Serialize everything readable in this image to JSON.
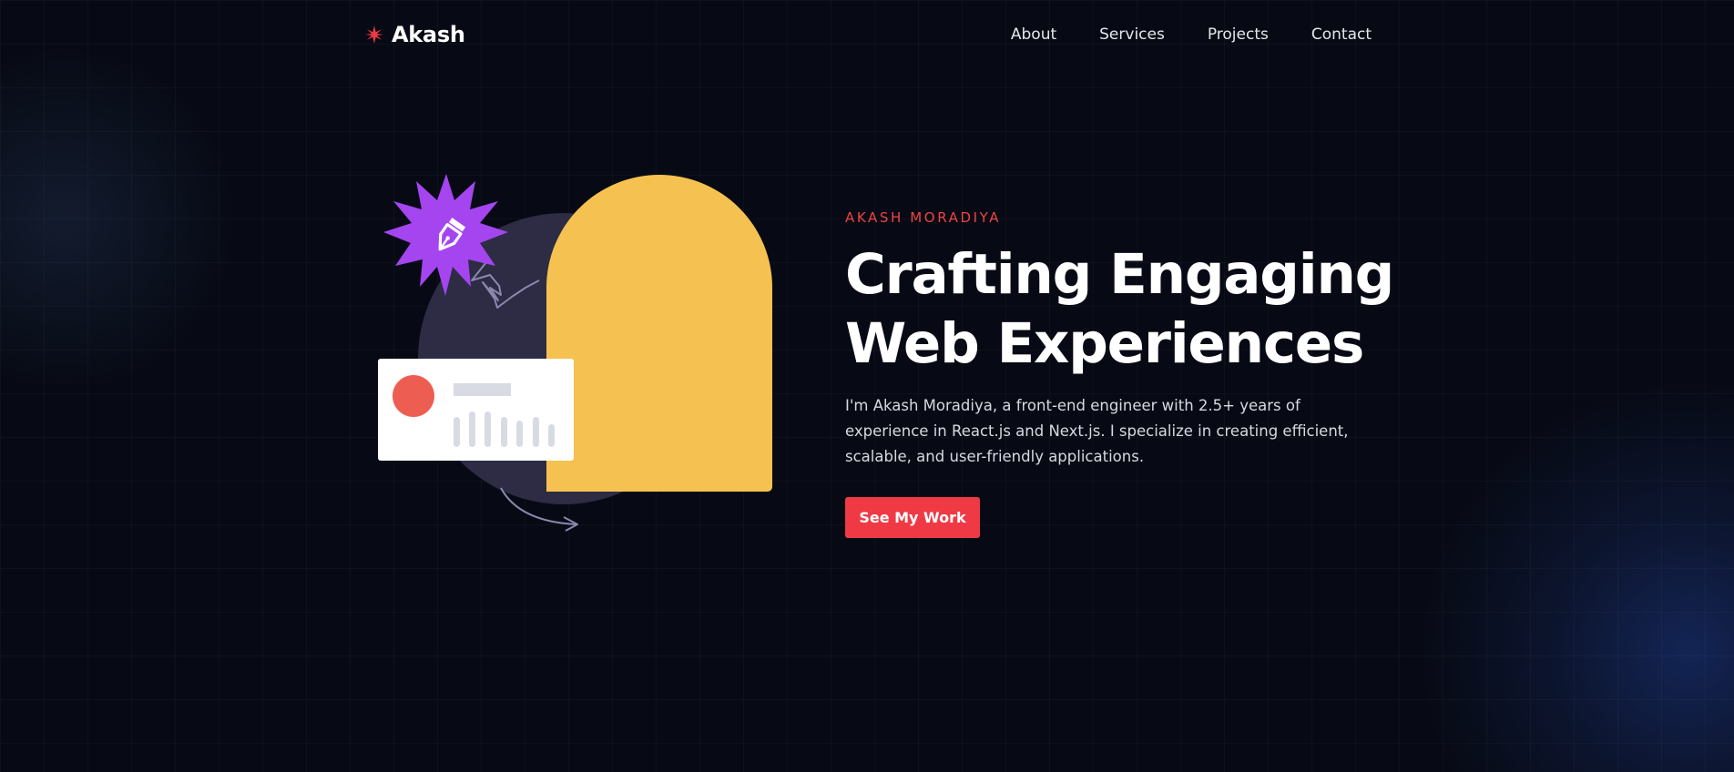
{
  "header": {
    "logo_icon": "sparkle-star-icon",
    "logo_text": "Akash",
    "nav": [
      {
        "label": "About"
      },
      {
        "label": "Services"
      },
      {
        "label": "Projects"
      },
      {
        "label": "Contact"
      }
    ]
  },
  "hero": {
    "eyebrow": "AKASH MORADIYA",
    "headline_line1": "Crafting Engaging",
    "headline_line2": "Web Experiences",
    "bio": "I'm Akash Moradiya, a front-end engineer with 2.5+ years of experience in React.js and Next.js. I specialize in creating efficient, scalable, and user-friendly applications.",
    "cta_label": "See My Work"
  },
  "illustration": {
    "badge_icon": "pen-nib-icon",
    "card_icon": "bar-chart-card-icon",
    "arrow_icon": "curved-arrow-icon"
  },
  "colors": {
    "background": "#070a14",
    "accent_red": "#ef3a46",
    "yellow": "#f5c150",
    "purple": "#a445f0",
    "circle": "#2d2c44",
    "card": "#ffffff",
    "card_dot": "#ee5d52"
  }
}
